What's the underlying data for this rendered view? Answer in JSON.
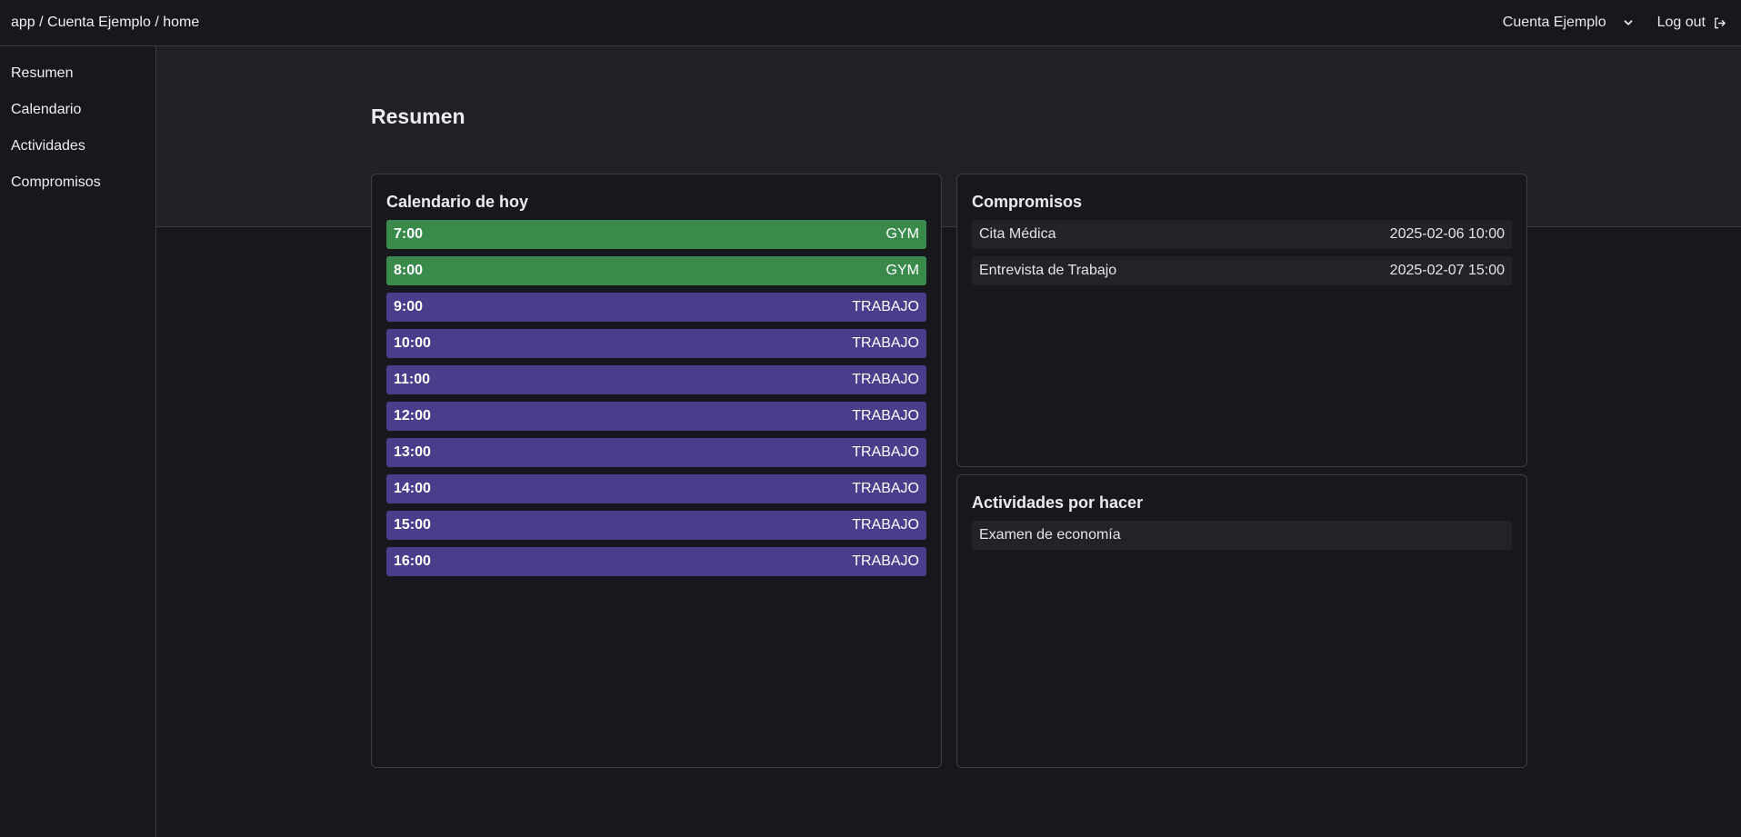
{
  "header": {
    "breadcrumb": "app / Cuenta Ejemplo / home",
    "account_name": "Cuenta Ejemplo",
    "logout_label": "Log out"
  },
  "sidebar": {
    "items": [
      {
        "label": "Resumen"
      },
      {
        "label": "Calendario"
      },
      {
        "label": "Actividades"
      },
      {
        "label": "Compromisos"
      }
    ]
  },
  "main": {
    "title": "Resumen",
    "calendar": {
      "title": "Calendario de hoy",
      "rows": [
        {
          "time": "7:00",
          "label": "GYM",
          "kind": "gym"
        },
        {
          "time": "8:00",
          "label": "GYM",
          "kind": "gym"
        },
        {
          "time": "9:00",
          "label": "TRABAJO",
          "kind": "trabajo"
        },
        {
          "time": "10:00",
          "label": "TRABAJO",
          "kind": "trabajo"
        },
        {
          "time": "11:00",
          "label": "TRABAJO",
          "kind": "trabajo"
        },
        {
          "time": "12:00",
          "label": "TRABAJO",
          "kind": "trabajo"
        },
        {
          "time": "13:00",
          "label": "TRABAJO",
          "kind": "trabajo"
        },
        {
          "time": "14:00",
          "label": "TRABAJO",
          "kind": "trabajo"
        },
        {
          "time": "15:00",
          "label": "TRABAJO",
          "kind": "trabajo"
        },
        {
          "time": "16:00",
          "label": "TRABAJO",
          "kind": "trabajo"
        }
      ]
    },
    "compromisos": {
      "title": "Compromisos",
      "items": [
        {
          "name": "Cita Médica",
          "datetime": "2025-02-06 10:00"
        },
        {
          "name": "Entrevista de Trabajo",
          "datetime": "2025-02-07 15:00"
        }
      ]
    },
    "actividades": {
      "title": "Actividades por hacer",
      "items": [
        {
          "name": "Examen de economía"
        }
      ]
    }
  },
  "colors": {
    "gym": "#3a8a4c",
    "trabajo": "#4a3e8c",
    "background": "#18181c",
    "hero": "#202025"
  },
  "icons": {
    "account_dropdown": "chevron-down-icon",
    "logout": "logout-icon"
  }
}
